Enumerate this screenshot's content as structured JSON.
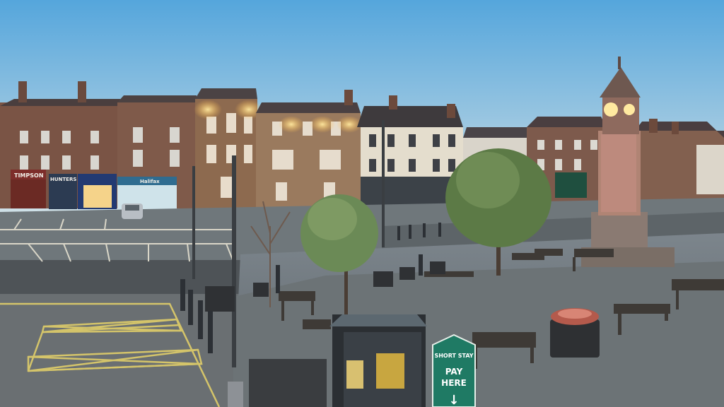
{
  "scene": {
    "description_tags": [
      "market-square",
      "clock-tower",
      "dusk",
      "webcam"
    ]
  },
  "shop_signs": {
    "left_shop": "TIMPSON",
    "second_shop": "HUNTERS",
    "right_shop": "Halifax"
  },
  "short_stay_sign": {
    "line1": "SHORT STAY",
    "line2": "PAY",
    "line3": "HERE",
    "arrow": "↓"
  },
  "colors": {
    "sky_top": "#4fa0d8",
    "sky_bottom": "#c8dbe4",
    "sign_teal": "#1f7a64",
    "parking_lines": "#d4c46a",
    "lamp_glow": "#ffd36a"
  }
}
